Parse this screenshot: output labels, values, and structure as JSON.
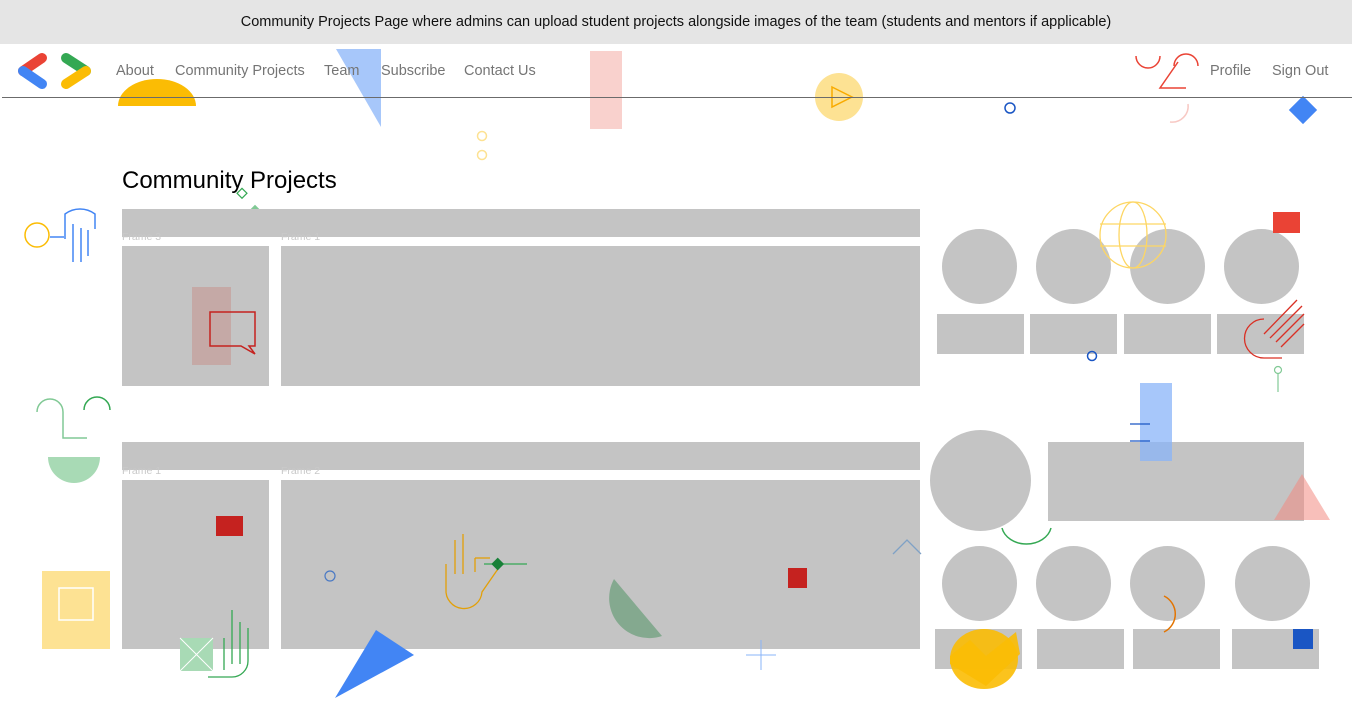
{
  "banner": {
    "text": "Community Projects Page where admins can upload student projects alongside images of the team (students and mentors if applicable)"
  },
  "nav": {
    "links": [
      "About",
      "Community Projects",
      "Team",
      "Subscribe",
      "Contact Us"
    ],
    "right_links": [
      "Profile",
      "Sign Out"
    ]
  },
  "page": {
    "title": "Community Projects"
  },
  "sections": [
    {
      "frames": [
        "Frame 3",
        "Frame 1"
      ]
    },
    {
      "frames": [
        "Frame 1",
        "Frame 2"
      ]
    }
  ],
  "colors": {
    "placeholder": "#c4c4c4",
    "google_blue": "#4285f4",
    "google_red": "#ea4335",
    "google_yellow": "#fbbc04",
    "google_green": "#34a853"
  },
  "icons": [
    "gdg-logo",
    "decorative-shapes"
  ]
}
